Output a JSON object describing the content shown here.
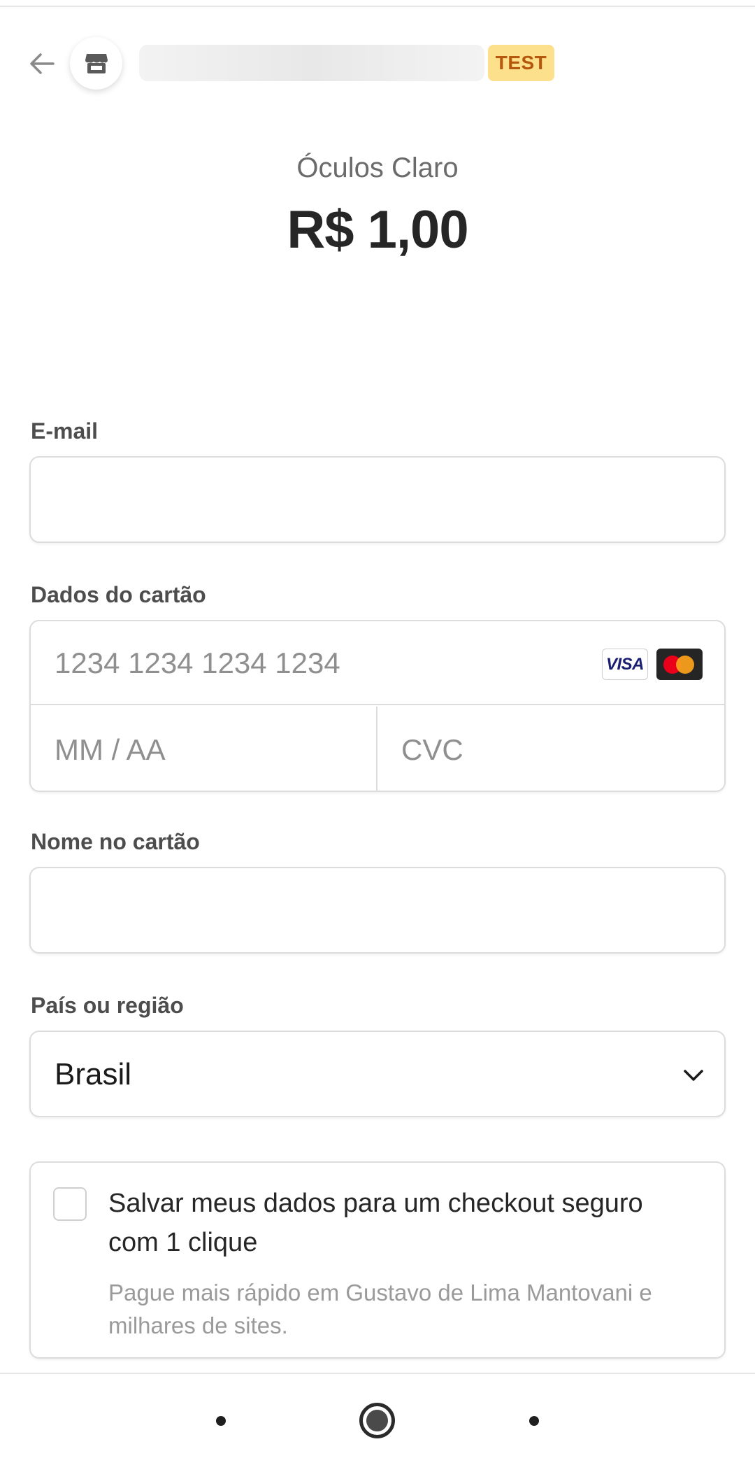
{
  "header": {
    "back_icon": "arrow-left-icon",
    "store_icon": "storefront-icon",
    "merchant_name": "",
    "badge": "TEST"
  },
  "product": {
    "name": "Óculos Claro",
    "price": "R$ 1,00"
  },
  "form": {
    "email_label": "E-mail",
    "email_value": "",
    "card_label": "Dados do cartão",
    "card_number_placeholder": "1234 1234 1234 1234",
    "card_expiry_placeholder": "MM / AA",
    "card_cvc_placeholder": "CVC",
    "card_brands": [
      "VISA",
      "mastercard"
    ],
    "name_label": "Nome no cartão",
    "name_value": "",
    "country_label": "País ou região",
    "country_value": "Brasil"
  },
  "save_info": {
    "title": "Salvar meus dados para um checkout seguro com 1 clique",
    "subtitle": "Pague mais rápido em Gustavo de Lima Mantovani e milhares de sites.",
    "checked": false
  },
  "colors": {
    "badge_bg": "#fde08b",
    "badge_text": "#b5570c",
    "border": "#dcdcdc"
  },
  "nav": {
    "icons": [
      "back-nav-icon",
      "home-nav-icon",
      "recents-nav-icon"
    ]
  }
}
